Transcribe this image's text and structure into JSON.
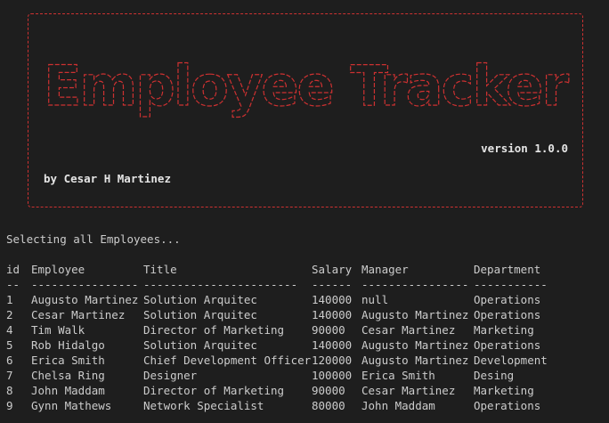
{
  "banner": {
    "title": "Employee Tracker",
    "version": "version 1.0.0",
    "author": "by Cesar H Martinez"
  },
  "colors": {
    "background": "#1e1e1e",
    "text": "#cccccc",
    "accent_red": "#cd3131"
  },
  "status_message": "Selecting all Employees...",
  "table": {
    "headers": [
      "id",
      "Employee",
      "Title",
      "Salary",
      "Manager",
      "Department"
    ],
    "separators": [
      "--",
      "----------------",
      "-----------------------",
      "------",
      "----------------",
      "-----------"
    ],
    "rows": [
      [
        "1",
        "Augusto Martinez",
        "Solution Arquitec",
        "140000",
        "null",
        "Operations"
      ],
      [
        "2",
        "Cesar Martinez",
        "Solution Arquitec",
        "140000",
        "Augusto Martinez",
        "Operations"
      ],
      [
        "4",
        "Tim Walk",
        "Director of Marketing",
        "90000",
        "Cesar Martinez",
        "Marketing"
      ],
      [
        "5",
        "Rob Hidalgo",
        "Solution Arquitec",
        "140000",
        "Augusto Martinez",
        "Operations"
      ],
      [
        "6",
        "Erica Smith",
        "Chief Development Officer",
        "120000",
        "Augusto Martinez",
        "Development"
      ],
      [
        "7",
        "Chelsa Ring",
        "Designer",
        "100000",
        "Erica Smith",
        "Desing"
      ],
      [
        "8",
        "John Maddam",
        "Director of Marketing",
        "90000",
        "Cesar Martinez",
        "Marketing"
      ],
      [
        "9",
        "Gynn Mathews",
        "Network Specialist",
        "80000",
        "John Maddam",
        "Operations"
      ]
    ]
  }
}
